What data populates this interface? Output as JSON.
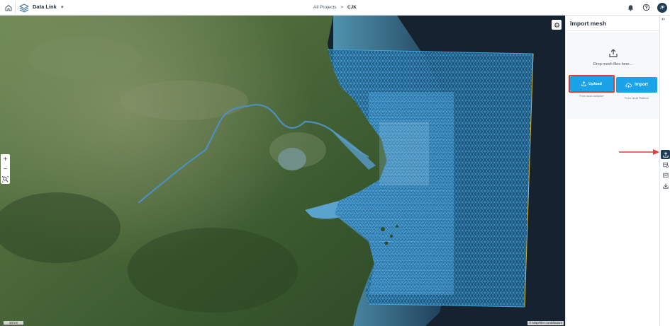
{
  "header": {
    "app_name": "Data Link",
    "breadcrumbs": [
      "All Projects",
      "CJK"
    ],
    "breadcrumb_separator": ">",
    "avatar_initials": "JP",
    "icons": {
      "home": "home-icon",
      "logo": "datalink-logo-icon",
      "app_menu": "chevron-down-icon",
      "notifications": "bell-icon",
      "help": "help-circle-icon"
    }
  },
  "map": {
    "settings_icon": "gear-icon",
    "zoom_in_label": "+",
    "zoom_out_label": "−",
    "zoom_fit_icon": "zoom-extent-icon",
    "scale_label": "30 km",
    "attribution": "© MapTiler contributors",
    "mesh_color": "#3fa9e6",
    "mesh_boundary_color": "#e0b020"
  },
  "import_panel": {
    "title": "Import mesh",
    "drop_text": "Drop mesh files here...",
    "upload": {
      "label": "Upload",
      "subtitle": "From local computer",
      "icon": "upload-icon"
    },
    "import": {
      "label": "Import",
      "subtitle": "From cloud Platform",
      "icon": "cloud-download-icon"
    },
    "accent_color": "#1aa3e8",
    "highlight_color": "#e53935"
  },
  "rail": {
    "collapse_icon": "double-chevron-right-icon",
    "items": [
      {
        "name": "import-mesh",
        "icon": "upload-icon",
        "active": true
      },
      {
        "name": "mesh-settings",
        "icon": "mesh-settings-icon",
        "active": false
      },
      {
        "name": "mesh-properties",
        "icon": "mesh-properties-icon",
        "active": false
      },
      {
        "name": "export-mesh",
        "icon": "download-icon",
        "active": false
      }
    ]
  }
}
